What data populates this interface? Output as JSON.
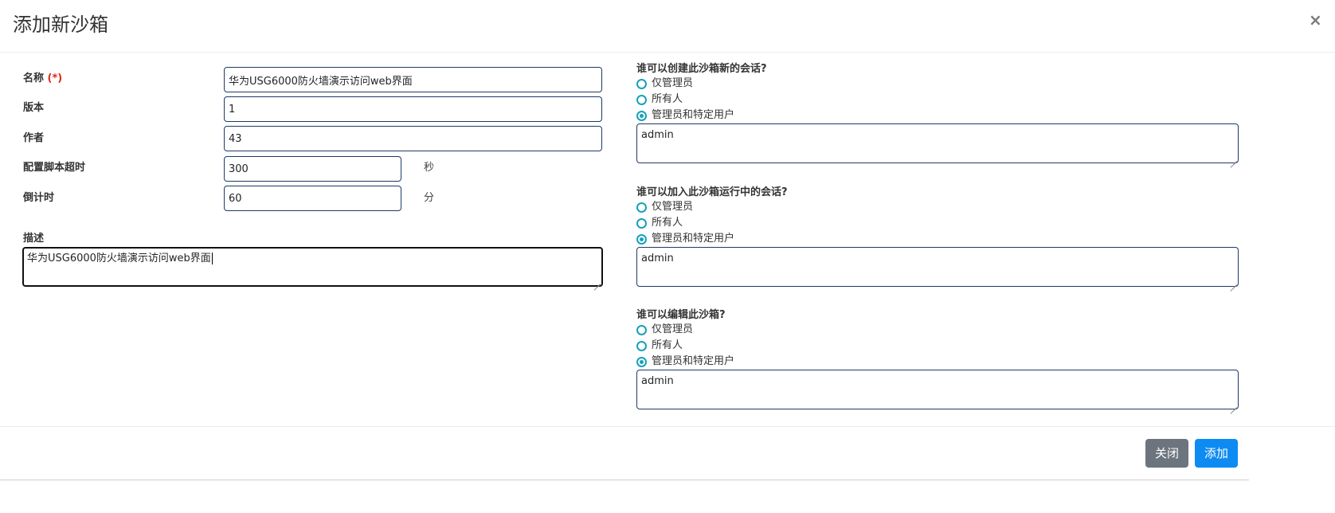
{
  "modal": {
    "title": "添加新沙箱",
    "close_symbol": "×"
  },
  "form": {
    "name": {
      "label": "名称",
      "required_mark": "(*)",
      "value": "华为USG6000防火墙演示访问web界面"
    },
    "version": {
      "label": "版本",
      "value": "1"
    },
    "author": {
      "label": "作者",
      "value": "43"
    },
    "script_timeout": {
      "label": "配置脚本超时",
      "value": "300",
      "unit": "秒"
    },
    "countdown": {
      "label": "倒计时",
      "value": "60",
      "unit": "分"
    },
    "description": {
      "label": "描述",
      "value": "华为USG6000防火墙演示访问web界面"
    }
  },
  "permissions": [
    {
      "title": "谁可以创建此沙箱新的会话?",
      "options": [
        "仅管理员",
        "所有人",
        "管理员和特定用户"
      ],
      "selected_index": 2,
      "users": "admin"
    },
    {
      "title": "谁可以加入此沙箱运行中的会话?",
      "options": [
        "仅管理员",
        "所有人",
        "管理员和特定用户"
      ],
      "selected_index": 2,
      "users": "admin"
    },
    {
      "title": "谁可以编辑此沙箱?",
      "options": [
        "仅管理员",
        "所有人",
        "管理员和特定用户"
      ],
      "selected_index": 2,
      "users": "admin"
    }
  ],
  "footer": {
    "close_label": "关闭",
    "add_label": "添加"
  },
  "colors": {
    "radio_accent": "#17a2b8",
    "close_button": "#6c757d",
    "add_button": "#0d8bf2",
    "required": "#e0281b",
    "input_border": "#1e3a66"
  },
  "icons": {
    "close": "close-icon",
    "radio": "radio-icon",
    "resize": "resize-grip-icon"
  }
}
